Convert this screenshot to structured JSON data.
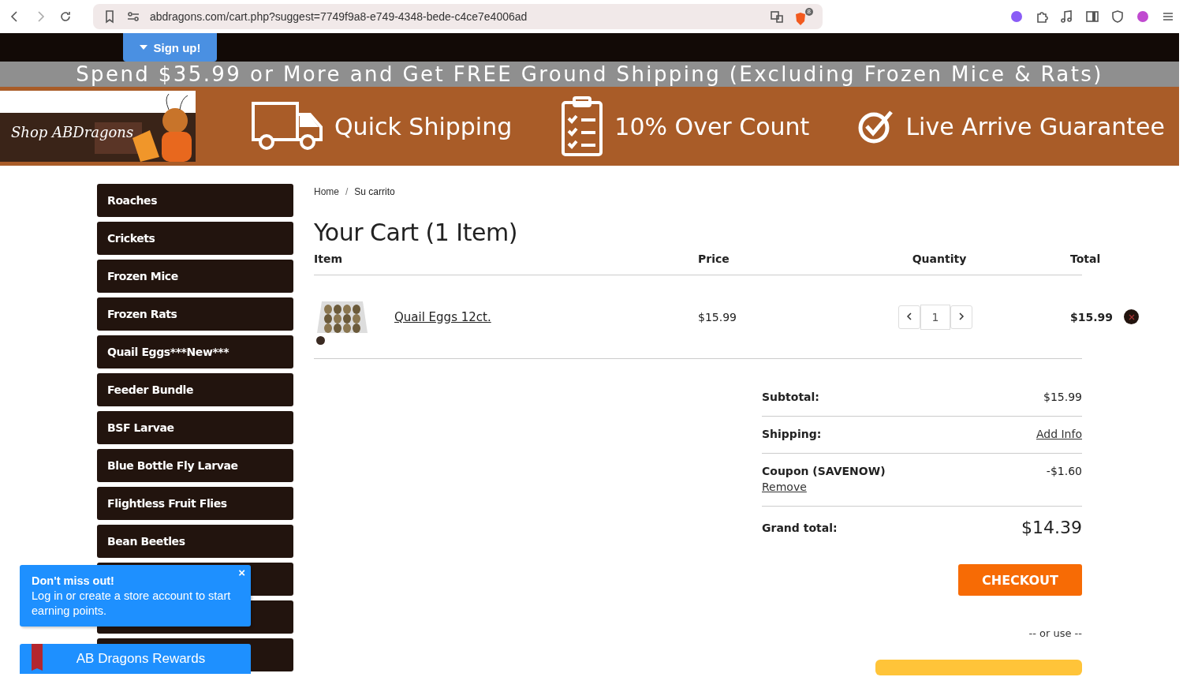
{
  "browser": {
    "url": "abdragons.com/cart.php?suggest=7749f9a8-e749-4348-bede-c4ce7e4006ad",
    "shield_badge": "8"
  },
  "header": {
    "signup_button": "Sign up!",
    "promo": "Spend $35.99 or More and Get FREE Ground Shipping (Excluding Frozen Mice & Rats)",
    "logo_text": "Shop ABDragons",
    "features": [
      {
        "kind": "truck",
        "label": "Quick Shipping"
      },
      {
        "kind": "checklist",
        "label": "10% Over Count"
      },
      {
        "kind": "check",
        "label": "Live Arrive Guarantee"
      }
    ]
  },
  "sidebar": {
    "items": [
      {
        "kind": "link",
        "label": "Roaches"
      },
      {
        "kind": "link",
        "label": "Crickets"
      },
      {
        "kind": "link",
        "label": "Frozen Mice"
      },
      {
        "kind": "link",
        "label": "Frozen Rats"
      },
      {
        "kind": "link",
        "label": "Quail Eggs***New***"
      },
      {
        "kind": "link",
        "label": "Feeder Bundle"
      },
      {
        "kind": "link",
        "label": "BSF Larvae"
      },
      {
        "kind": "link",
        "label": "Blue Bottle Fly Larvae"
      },
      {
        "kind": "link",
        "label": "Flightless Fruit Flies"
      },
      {
        "kind": "link",
        "label": "Bean Beetles"
      },
      {
        "kind": "covered"
      },
      {
        "kind": "covered"
      },
      {
        "kind": "covered"
      }
    ]
  },
  "breadcrumb": [
    {
      "label": "Home",
      "kind": "link"
    },
    {
      "label": "/",
      "kind": "separator"
    },
    {
      "label": "Su carrito",
      "kind": "current"
    }
  ],
  "cart": {
    "title": "Your Cart (1 Item)",
    "columns": [
      "Item",
      "Price",
      "Quantity",
      "Total"
    ],
    "items": [
      {
        "name": "Quail Eggs 12ct.",
        "price": "$15.99",
        "quantity": "1",
        "total": "$15.99"
      }
    ]
  },
  "summary": {
    "rows": [
      {
        "kind": "amount",
        "label": "Subtotal:",
        "value": "$15.99"
      },
      {
        "kind": "link",
        "label": "Shipping:",
        "value": "Add Info"
      },
      {
        "kind": "coupon",
        "label": "Coupon (SAVENOW)",
        "value": "-$1.60",
        "action": "Remove"
      }
    ],
    "grand_label": "Grand total:",
    "grand_value": "$14.39",
    "checkout": "CHECKOUT",
    "or_use": "-- or use --"
  },
  "popup": {
    "title": "Don't miss out!",
    "text": "Log in or create a store account to start earning points.",
    "close": "×"
  },
  "rewards": {
    "label": "AB Dragons Rewards"
  }
}
